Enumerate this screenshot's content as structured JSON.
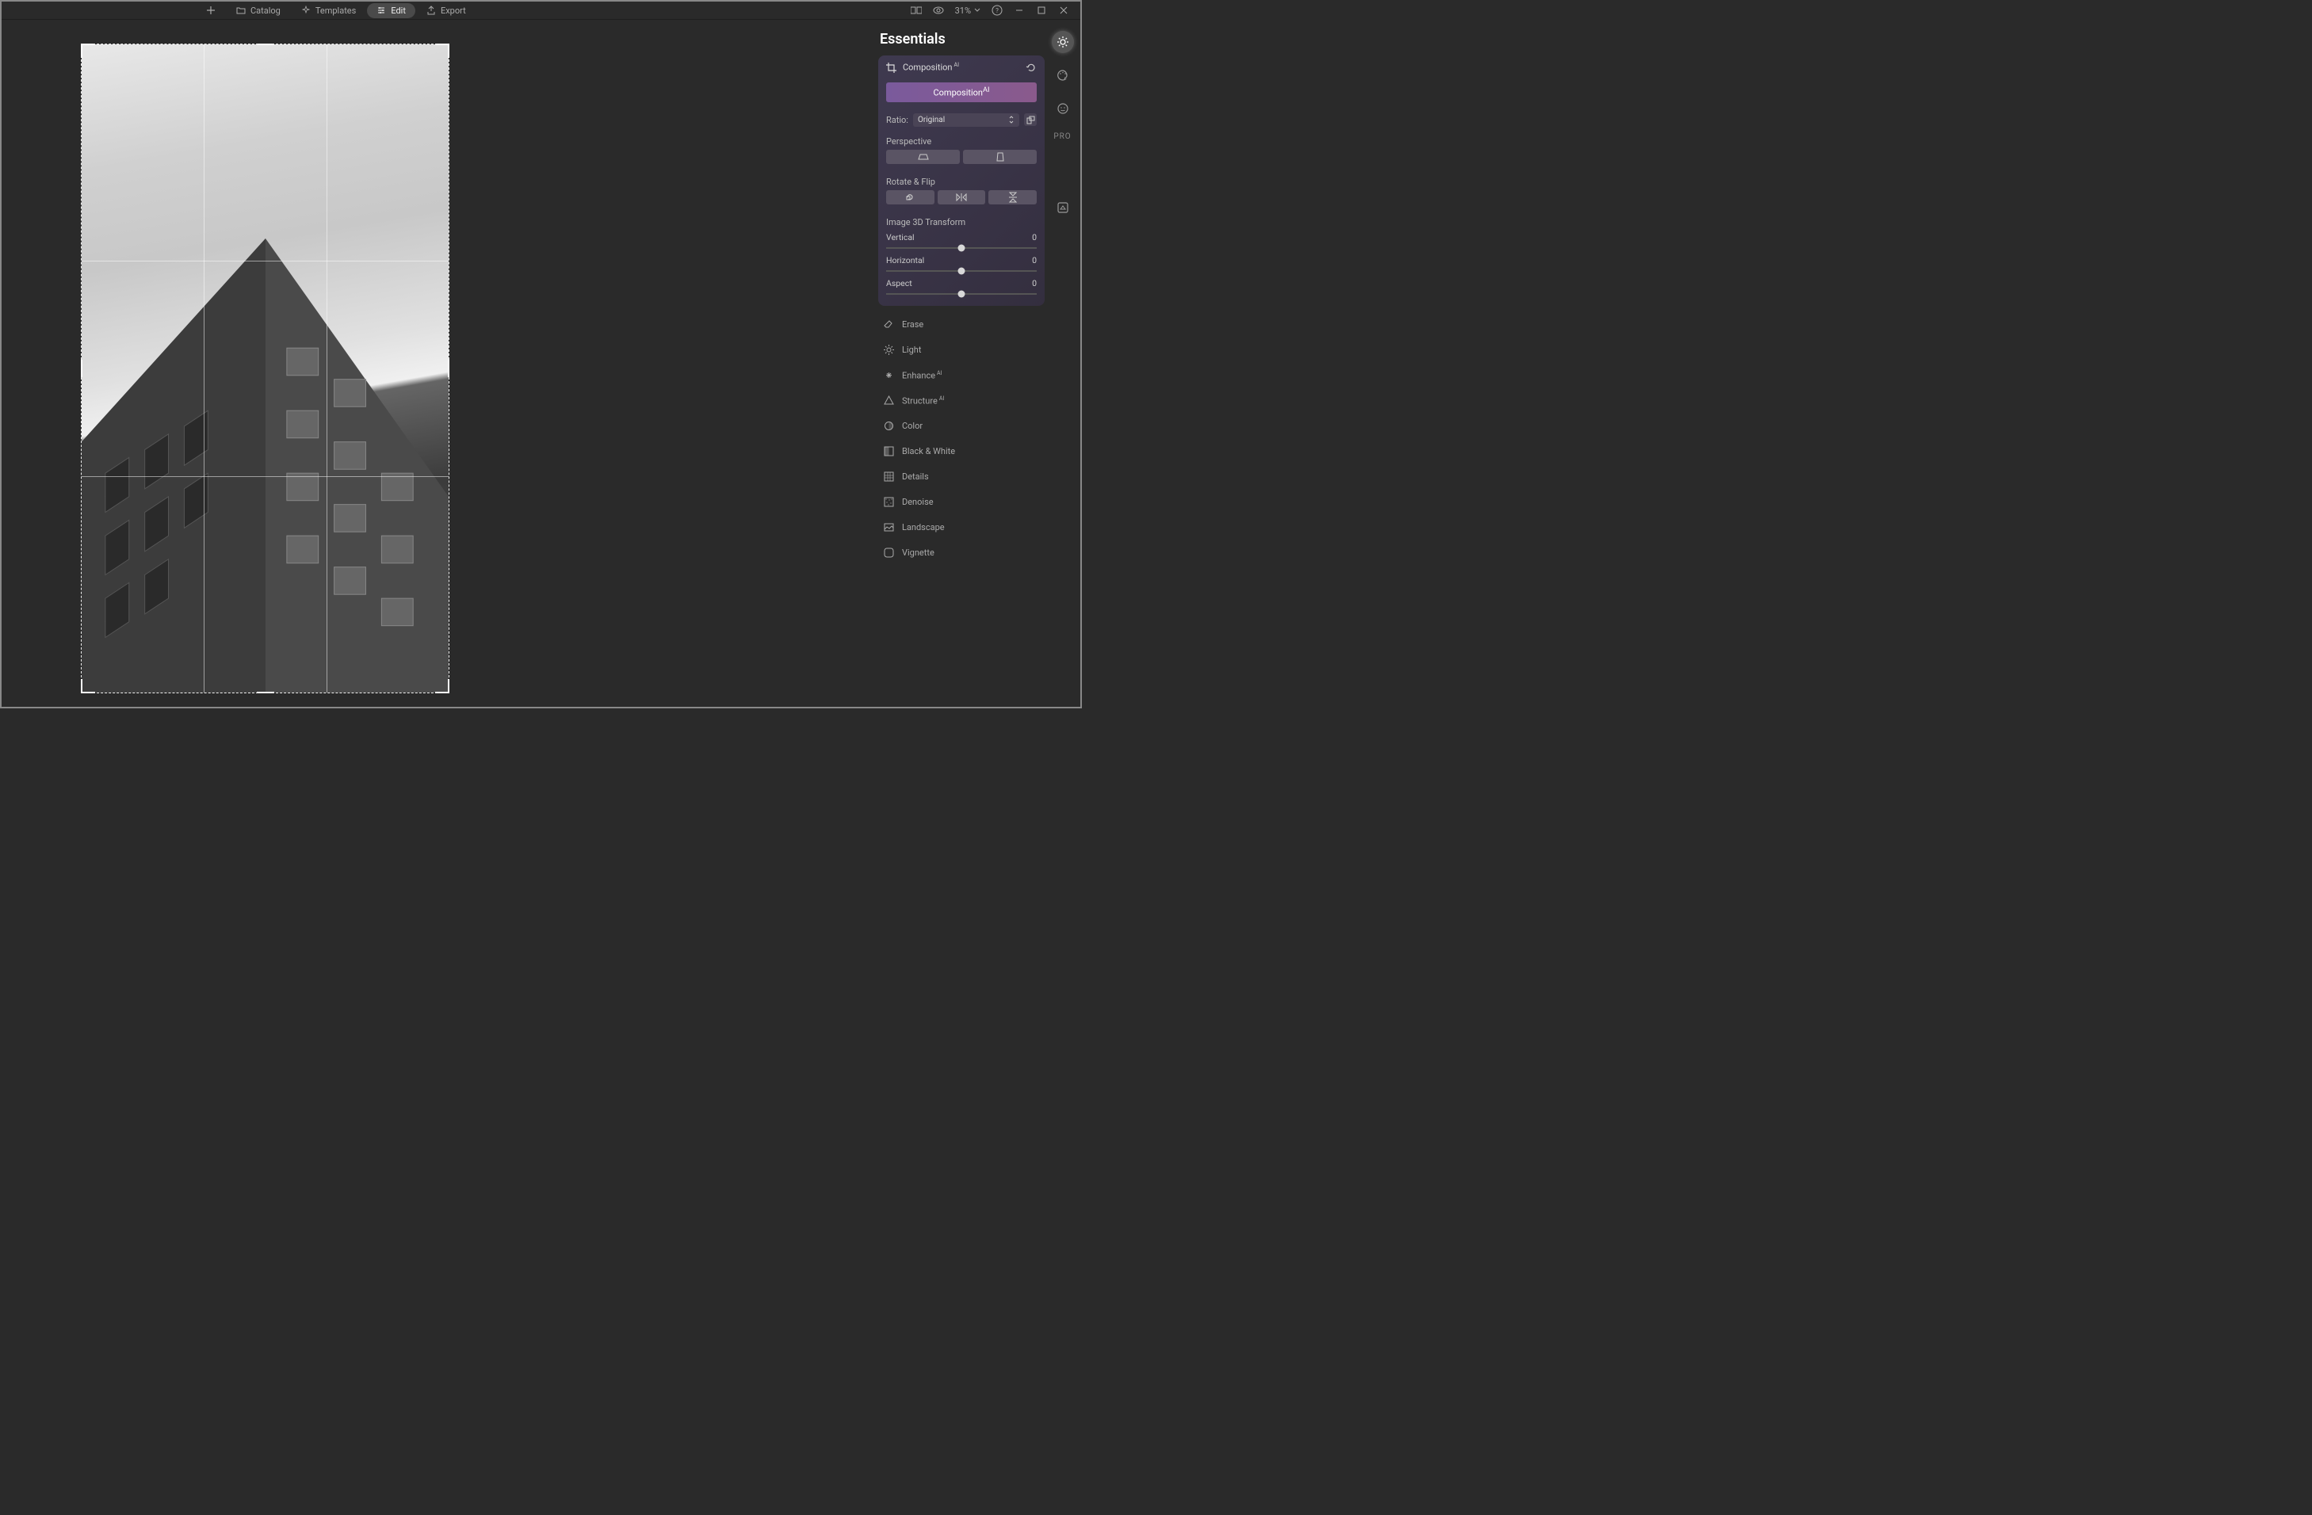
{
  "topbar": {
    "catalog": "Catalog",
    "templates": "Templates",
    "edit": "Edit",
    "export": "Export",
    "zoom": "31%"
  },
  "panel": {
    "title": "Essentials",
    "composition": {
      "label": "Composition",
      "button": "Composition",
      "ratio_label": "Ratio:",
      "ratio_value": "Original",
      "perspective_label": "Perspective",
      "rotate_label": "Rotate & Flip",
      "transform_label": "Image 3D Transform",
      "sliders": {
        "vertical": {
          "label": "Vertical",
          "value": "0"
        },
        "horizontal": {
          "label": "Horizontal",
          "value": "0"
        },
        "aspect": {
          "label": "Aspect",
          "value": "0"
        }
      }
    },
    "tools": {
      "erase": "Erase",
      "light": "Light",
      "enhance": "Enhance",
      "structure": "Structure",
      "color": "Color",
      "bw": "Black & White",
      "details": "Details",
      "denoise": "Denoise",
      "landscape": "Landscape",
      "vignette": "Vignette"
    }
  },
  "toolstrip": {
    "pro": "PRO"
  }
}
